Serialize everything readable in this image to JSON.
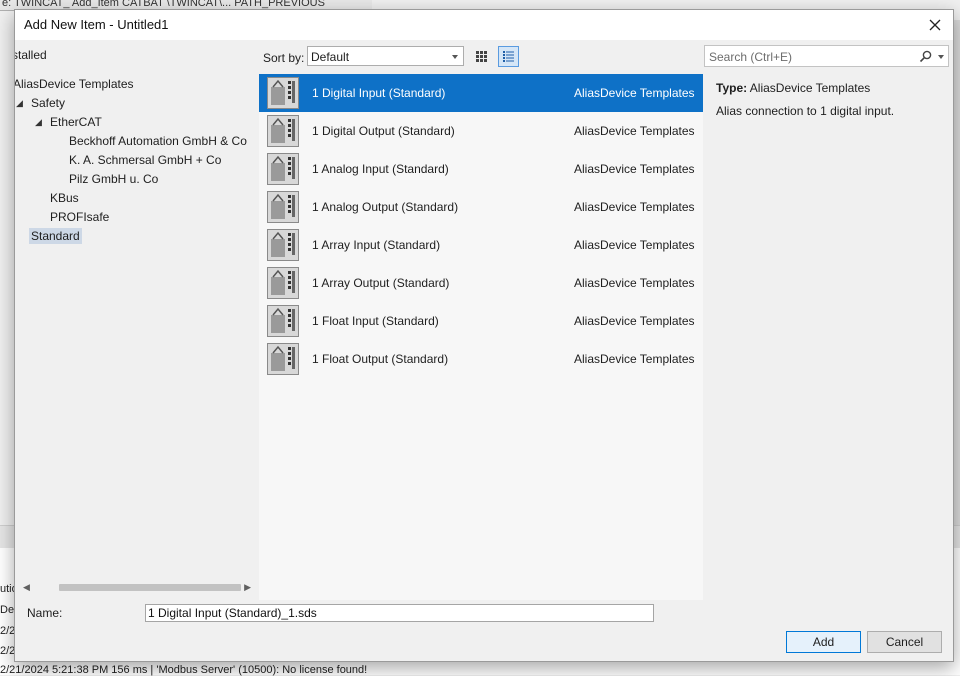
{
  "background": {
    "top_text": "e:  TWINCAT_  Add_Item  CATBAT      \\TWINCAT\\...   PATH_PREVIOUS",
    "log_lines": [
      {
        "text": "utio"
      },
      {
        "text": "Des"
      },
      {
        "text": "2/2"
      },
      {
        "text": "2/2"
      },
      {
        "text": "2/21/2024 5:21:38 PM 156 ms | 'Modbus Server' (10500): No license found!"
      }
    ]
  },
  "dialog": {
    "title": "Add New Item - Untitled1",
    "close_icon": "close-icon"
  },
  "left_pane": {
    "installed_label": "stalled",
    "tree": [
      {
        "label": "AliasDevice Templates",
        "expander": ""
      },
      {
        "label": "Safety",
        "expander": "◢"
      },
      {
        "label": "EtherCAT",
        "expander": "◢"
      },
      {
        "label": "Beckhoff Automation GmbH & Co",
        "expander": ""
      },
      {
        "label": "K. A. Schmersal GmbH + Co",
        "expander": ""
      },
      {
        "label": "Pilz GmbH u. Co",
        "expander": ""
      },
      {
        "label": "KBus",
        "expander": ""
      },
      {
        "label": "PROFIsafe",
        "expander": ""
      },
      {
        "label": "Standard",
        "expander": "",
        "selected": true
      }
    ]
  },
  "sortbar": {
    "label": "Sort by:",
    "value": "Default",
    "views": [
      "grid-view-icon",
      "list-view-icon"
    ]
  },
  "items": [
    {
      "name": "1 Digital Input (Standard)",
      "category": "AliasDevice Templates",
      "selected": true
    },
    {
      "name": "1 Digital Output (Standard)",
      "category": "AliasDevice Templates"
    },
    {
      "name": "1 Analog Input (Standard)",
      "category": "AliasDevice Templates"
    },
    {
      "name": "1 Analog Output (Standard)",
      "category": "AliasDevice Templates"
    },
    {
      "name": "1 Array Input (Standard)",
      "category": "AliasDevice Templates"
    },
    {
      "name": "1 Array Output (Standard)",
      "category": "AliasDevice Templates"
    },
    {
      "name": "1 Float Input (Standard)",
      "category": "AliasDevice Templates"
    },
    {
      "name": "1 Float Output (Standard)",
      "category": "AliasDevice Templates"
    }
  ],
  "search": {
    "placeholder": "Search (Ctrl+E)"
  },
  "details": {
    "type_label": "Type:",
    "type_value": "AliasDevice Templates",
    "description": "Alias connection to 1 digital input."
  },
  "bottom": {
    "name_label": "Name:",
    "name_value": "1 Digital Input (Standard)_1.sds",
    "add_label": "Add",
    "cancel_label": "Cancel"
  },
  "colors": {
    "selection": "#0e71c7",
    "tree_selection": "#cdd8e6",
    "accent_border": "#0078d7"
  }
}
